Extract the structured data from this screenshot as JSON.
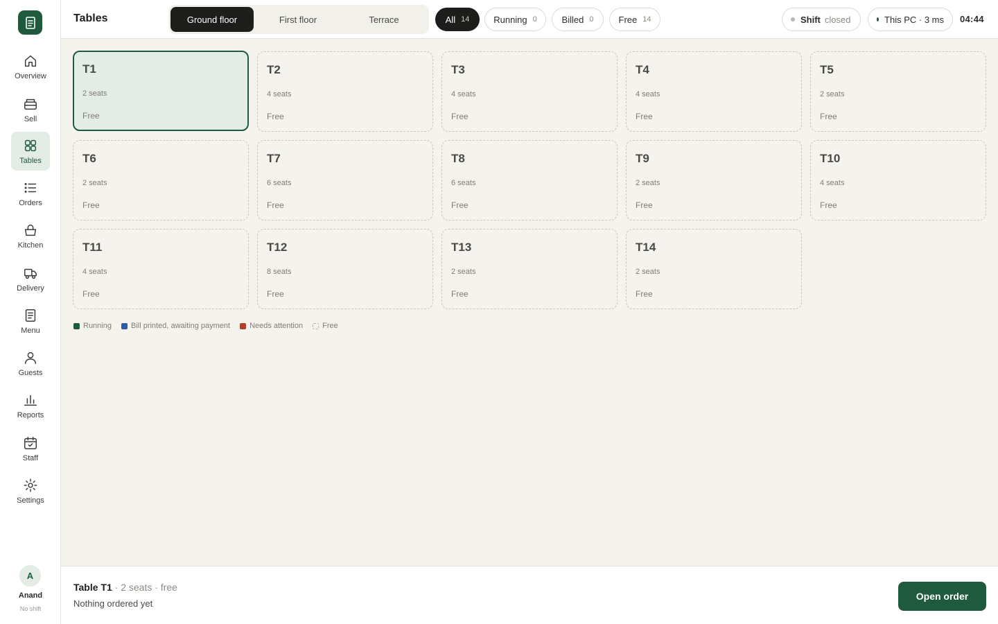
{
  "app": {
    "page_title": "Tables",
    "user": {
      "initial": "A",
      "name": "Anand",
      "shift": "No shift"
    },
    "clock": "04:44"
  },
  "sidebar": {
    "items": [
      {
        "label": "Overview",
        "icon": "home-icon",
        "active": false
      },
      {
        "label": "Sell",
        "icon": "register-icon",
        "active": false
      },
      {
        "label": "Tables",
        "icon": "grid-icon",
        "active": true
      },
      {
        "label": "Orders",
        "icon": "list-icon",
        "active": false
      },
      {
        "label": "Kitchen",
        "icon": "basket-icon",
        "active": false
      },
      {
        "label": "Delivery",
        "icon": "delivery-icon",
        "active": false
      },
      {
        "label": "Menu",
        "icon": "menu-doc-icon",
        "active": false
      },
      {
        "label": "Guests",
        "icon": "user-icon",
        "active": false
      },
      {
        "label": "Reports",
        "icon": "bar-chart-icon",
        "active": false
      },
      {
        "label": "Staff",
        "icon": "calendar-check-icon",
        "active": false
      },
      {
        "label": "Settings",
        "icon": "gear-icon",
        "active": false
      }
    ]
  },
  "floors": {
    "selected": "Ground floor",
    "tabs": [
      "Ground floor",
      "First floor",
      "Terrace"
    ]
  },
  "filters": [
    {
      "label": "All",
      "count": "14",
      "active": true
    },
    {
      "label": "Running",
      "count": "0",
      "active": false
    },
    {
      "label": "Billed",
      "count": "0",
      "active": false
    },
    {
      "label": "Free",
      "count": "14",
      "active": false
    }
  ],
  "shift_status": {
    "label": "Shift",
    "value": "closed",
    "dot_color": "#b8b6ae"
  },
  "connection": {
    "label": "This PC · 3 ms",
    "dot_color": "#1f5a3f"
  },
  "tables": [
    {
      "name": "T1",
      "seats": "2 seats",
      "status": "Free",
      "selected": true
    },
    {
      "name": "T2",
      "seats": "4 seats",
      "status": "Free"
    },
    {
      "name": "T3",
      "seats": "4 seats",
      "status": "Free"
    },
    {
      "name": "T4",
      "seats": "4 seats",
      "status": "Free"
    },
    {
      "name": "T5",
      "seats": "2 seats",
      "status": "Free"
    },
    {
      "name": "T6",
      "seats": "2 seats",
      "status": "Free"
    },
    {
      "name": "T7",
      "seats": "6 seats",
      "status": "Free"
    },
    {
      "name": "T8",
      "seats": "6 seats",
      "status": "Free"
    },
    {
      "name": "T9",
      "seats": "2 seats",
      "status": "Free"
    },
    {
      "name": "T10",
      "seats": "4 seats",
      "status": "Free"
    },
    {
      "name": "T11",
      "seats": "4 seats",
      "status": "Free"
    },
    {
      "name": "T12",
      "seats": "8 seats",
      "status": "Free"
    },
    {
      "name": "T13",
      "seats": "2 seats",
      "status": "Free"
    },
    {
      "name": "T14",
      "seats": "2 seats",
      "status": "Free"
    }
  ],
  "legend": [
    {
      "label": "Running",
      "color": "#1f5a3f"
    },
    {
      "label": "Bill printed, awaiting payment",
      "color": "#2f5aa8"
    },
    {
      "label": "Needs attention",
      "color": "#b2402e"
    },
    {
      "label": "Free",
      "color": "none"
    }
  ],
  "footer": {
    "table_name": "Table T1",
    "table_meta": " · 2 seats · free",
    "note": "Nothing ordered yet",
    "action_label": "Open order"
  },
  "colors": {
    "brand": "#1f5a3f",
    "brand_light": "#e3ece5",
    "dark": "#1d1d1b",
    "background": "#f4f3ee"
  }
}
